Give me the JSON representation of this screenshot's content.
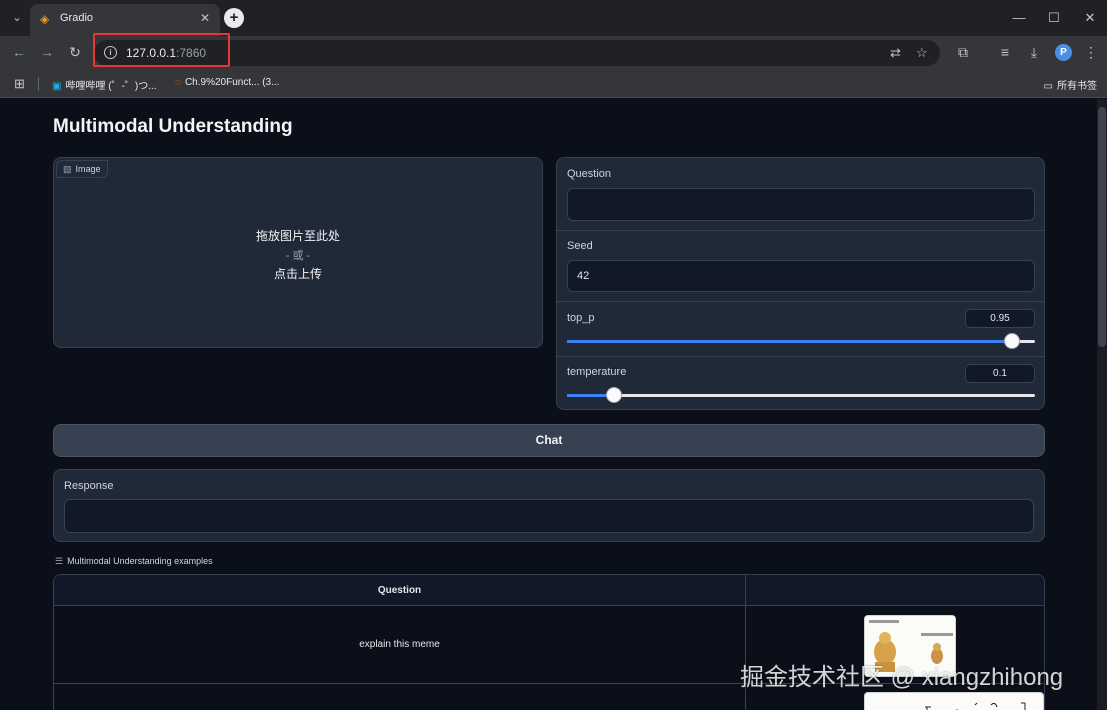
{
  "browser": {
    "tab_title": "Gradio",
    "url_host": "127.0.0.1",
    "url_port": ":7860",
    "bookmarks": [
      {
        "label": "哔哩哔哩 (゜-゜)つ..."
      },
      {
        "label": "Ch.9%20Funct... (3..."
      }
    ],
    "all_bookmarks_label": "所有书签"
  },
  "app": {
    "title": "Multimodal Understanding",
    "image": {
      "label": "Image",
      "drop_text": "拖放图片至此处",
      "or_text": "- 或 -",
      "click_text": "点击上传"
    },
    "question": {
      "label": "Question",
      "value": ""
    },
    "seed": {
      "label": "Seed",
      "value": "42"
    },
    "top_p": {
      "label": "top_p",
      "value": "0.95",
      "fraction": 0.95
    },
    "temperature": {
      "label": "temperature",
      "value": "0.1",
      "fraction": 0.1
    },
    "chat_button": "Chat",
    "response": {
      "label": "Response",
      "value": ""
    },
    "examples": {
      "label": "Multimodal Understanding examples",
      "header_question": "Question",
      "rows": [
        {
          "question": "explain this meme"
        }
      ]
    }
  },
  "watermark": "掘金技术社区 @ xiangzhihong"
}
